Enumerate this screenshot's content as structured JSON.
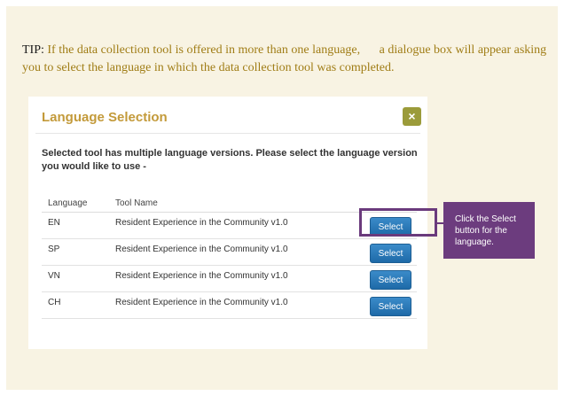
{
  "tip": {
    "label": "TIP:",
    "text_part1": "If the data collection tool is offered in more than one language,",
    "text_part2": "a dialogue box will appear asking you to select the language in which the data collection tool was completed."
  },
  "dialog": {
    "title": "Language Selection",
    "close_label": "×",
    "message": "Selected tool has multiple language versions. Please select the language version you would like to use -",
    "headers": {
      "language": "Language",
      "tool_name": "Tool Name"
    },
    "rows": [
      {
        "language": "EN",
        "tool": "Resident Experience in the Community v1.0",
        "button": "Select"
      },
      {
        "language": "SP",
        "tool": "Resident Experience in the Community v1.0",
        "button": "Select"
      },
      {
        "language": "VN",
        "tool": "Resident Experience in the Community v1.0",
        "button": "Select"
      },
      {
        "language": "CH",
        "tool": "Resident Experience in the Community v1.0",
        "button": "Select"
      }
    ]
  },
  "callout": {
    "text": "Click the Select button for the language."
  },
  "colors": {
    "panel_bg": "#f8f3e3",
    "tip_text": "#a07d16",
    "title": "#c39a3a",
    "close_button": "#9b9b3a",
    "select_button": "#2a78bb",
    "callout_bg": "#6c3c7e"
  },
  "icons": {
    "close": "close-icon"
  }
}
